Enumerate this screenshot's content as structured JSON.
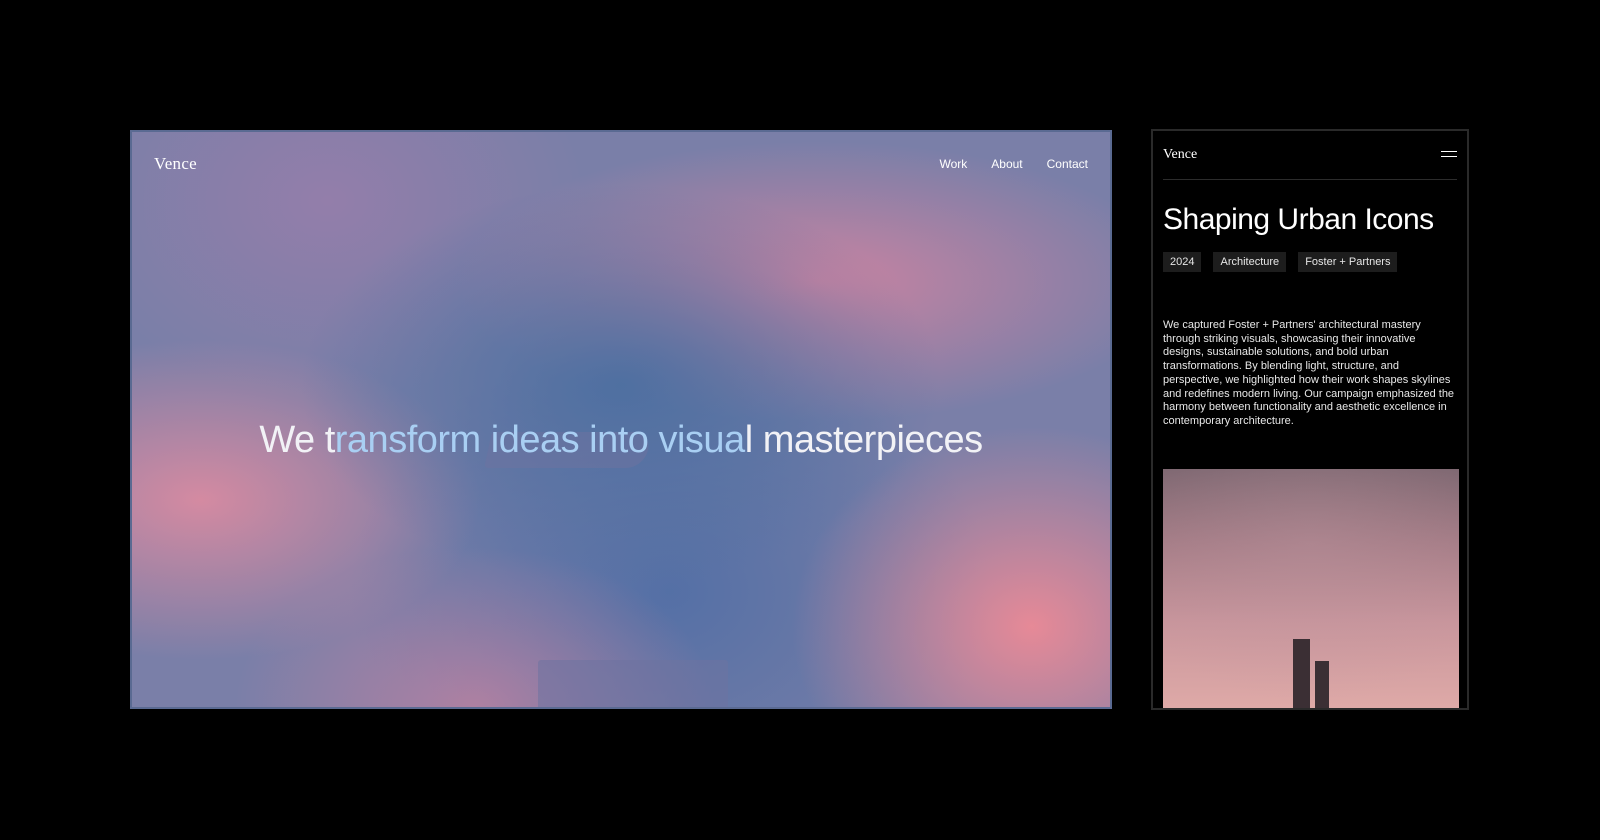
{
  "desktop": {
    "logo": "Vence",
    "nav": [
      {
        "label": "Work"
      },
      {
        "label": "About"
      },
      {
        "label": "Contact"
      }
    ],
    "hero": {
      "part1": "We t",
      "highlight": "ransform ideas into visua",
      "part2": "l masterpieces"
    }
  },
  "mobile": {
    "logo": "Vence",
    "menu_icon": "hamburger-icon",
    "title": "Shaping Urban Icons",
    "tags": [
      "2024",
      "Architecture",
      "Foster + Partners"
    ],
    "description": "We captured Foster + Partners' architectural mastery through striking visuals, showcasing their innovative designs, sustainable solutions, and bold urban transformations. By blending light, structure, and perspective, we highlighted how their work shapes skylines and redefines modern living. Our campaign emphasized the harmony between functionality and aesthetic excellence in contemporary architecture."
  },
  "colors": {
    "background": "#000000",
    "hero_highlight": "#a9cff3",
    "tag_bg": "#1d1d1d"
  }
}
